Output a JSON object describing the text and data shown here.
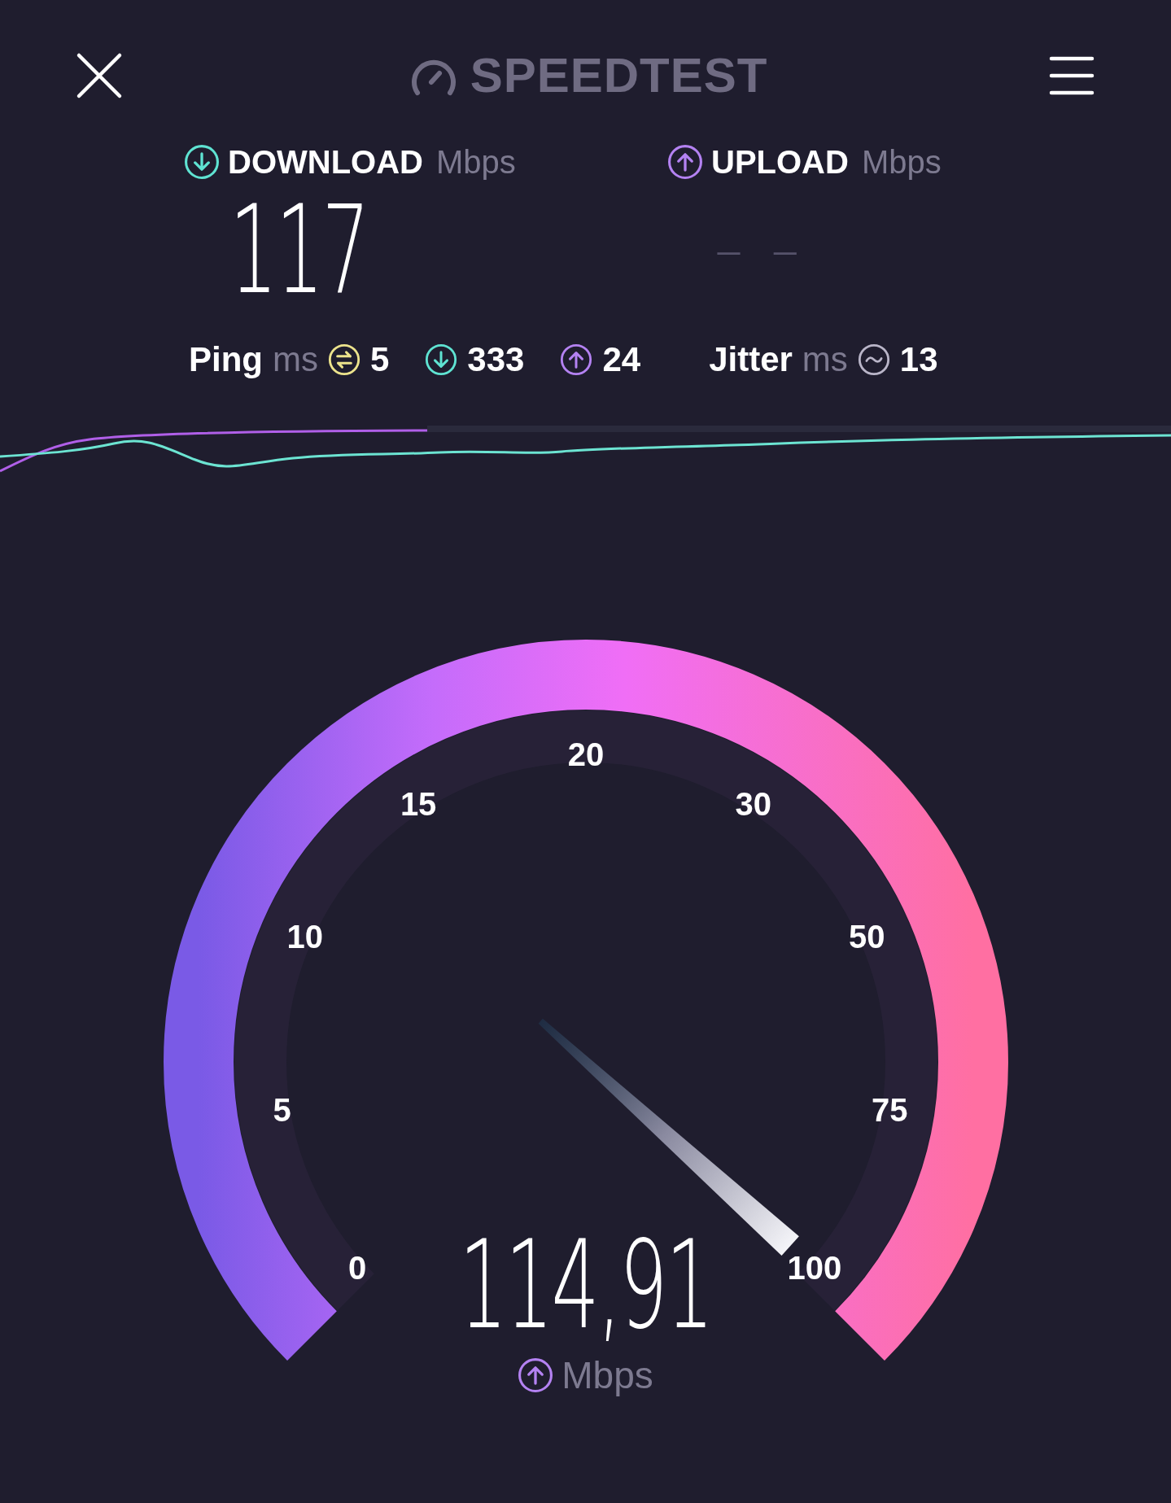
{
  "header": {
    "title": "SPEEDTEST"
  },
  "results": [
    {
      "kind": "download",
      "label": "DOWNLOAD",
      "unit": "Mbps",
      "value": "117"
    },
    {
      "kind": "upload",
      "label": "UPLOAD",
      "unit": "Mbps",
      "value": "– –"
    }
  ],
  "stats": [
    {
      "kind": "ping",
      "label": "Ping",
      "unit": "ms",
      "value": "5"
    },
    {
      "kind": "download",
      "value": "333"
    },
    {
      "kind": "upload",
      "value": "24"
    },
    {
      "kind": "jitter",
      "label": "Jitter",
      "unit": "ms",
      "value": "13"
    }
  ],
  "gauge": {
    "ticks": [
      "0",
      "5",
      "10",
      "15",
      "20",
      "30",
      "50",
      "75",
      "100"
    ],
    "reading": "114,91",
    "unit": "Mbps"
  }
}
